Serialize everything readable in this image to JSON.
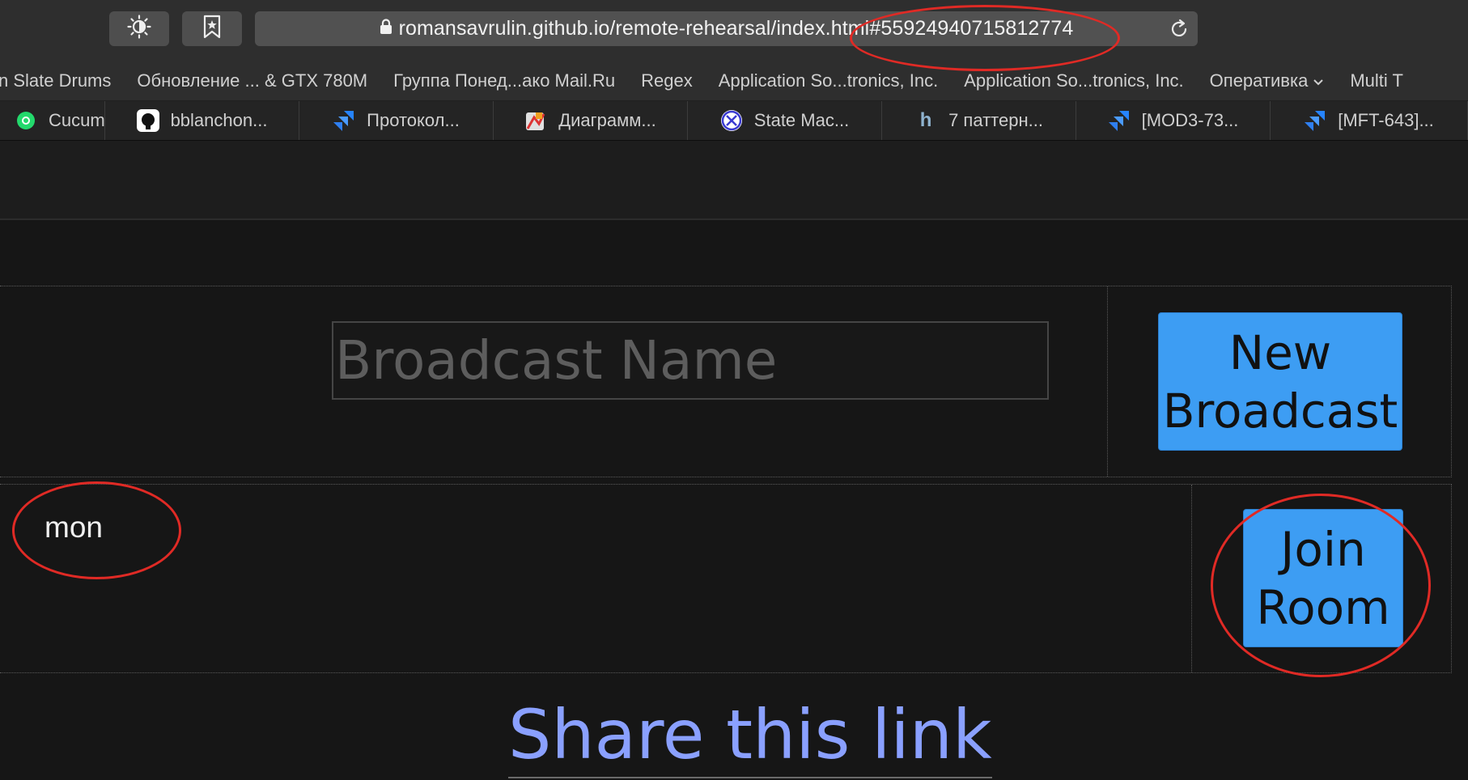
{
  "toolbar": {
    "theme_button_icon": "sun-icon",
    "bookmark_button_icon": "bookmark-star-icon",
    "url": "romansavrulin.github.io/remote-rehearsal/index.html#5592494071581277​4",
    "lock_icon": "lock-icon",
    "reload_icon": "reload-icon"
  },
  "bookmarks": [
    {
      "label": "n Slate Drums"
    },
    {
      "label": "Обновление ... & GTX 780M"
    },
    {
      "label": "Группа Понед...ако Mail.Ru"
    },
    {
      "label": "Regex"
    },
    {
      "label": "Application So...tronics, Inc."
    },
    {
      "label": "Application So...tronics, Inc."
    },
    {
      "label": "Оперативка"
    },
    {
      "label": "Multi T"
    }
  ],
  "tabs": [
    {
      "label": "Cucum",
      "icon": "cucumber-icon"
    },
    {
      "label": "bblanchon...",
      "icon": "github-icon"
    },
    {
      "label": "Протокол...",
      "icon": "jira-icon"
    },
    {
      "label": "Диаграмм...",
      "icon": "diagram-icon"
    },
    {
      "label": "State Mac...",
      "icon": "state-machine-icon"
    },
    {
      "label": "7 паттерн...",
      "icon": "habr-icon"
    },
    {
      "label": "[MOD3-73...",
      "icon": "jira-icon"
    },
    {
      "label": "[MFT-643]...",
      "icon": "jira-icon"
    }
  ],
  "main": {
    "broadcast_name_placeholder": "Broadcast Name",
    "broadcast_name_value": "",
    "new_broadcast_line1": "New",
    "new_broadcast_line2": "Broadcast",
    "room_text": "mon",
    "join_room_line1": "Join",
    "join_room_line2": "Room",
    "share_title": "Share this link"
  },
  "colors": {
    "accent_button": "#3d9df3",
    "share_title": "#8aa0ff",
    "annotation": "#e02a25"
  }
}
